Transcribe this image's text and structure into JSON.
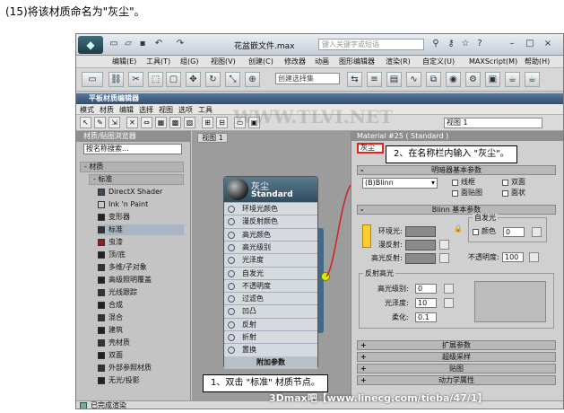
{
  "caption": "(15)将该材质命名为\"灰尘\"。",
  "app": {
    "doc_title": "花盆嵌文件.max",
    "search_placeholder": "键入关键字或短语",
    "menu": [
      "编辑(E)",
      "工具(T)",
      "组(G)",
      "视图(V)",
      "创建(C)",
      "修改器",
      "动画",
      "图形编辑器",
      "渲染(R)",
      "自定义(U)",
      "MAXScript(M)",
      "帮助(H)"
    ],
    "selection_set": "创建选择集"
  },
  "sme": {
    "title": "平板材质编辑器",
    "menu": [
      "模式",
      "材质",
      "编辑",
      "选择",
      "视图",
      "选项",
      "工具"
    ],
    "view_select": "视图 1"
  },
  "browser": {
    "header": "材质/贴图浏览器",
    "search": "按名称搜索...",
    "category": "- 材质",
    "subcategory": "- 标准",
    "items": [
      {
        "label": "DirectX Shader",
        "swatch": "#3a4a5a"
      },
      {
        "label": "Ink 'n Paint",
        "swatch": "#c8c8c8"
      },
      {
        "label": "变形器",
        "swatch": "#222222"
      },
      {
        "label": "标准",
        "swatch": "#333333"
      },
      {
        "label": "虫漆",
        "swatch": "#9a1a1a"
      },
      {
        "label": "顶/底",
        "swatch": "#222222"
      },
      {
        "label": "多维/子对象",
        "swatch": "#333333"
      },
      {
        "label": "高级照明覆盖",
        "swatch": "#222222"
      },
      {
        "label": "光线跟踪",
        "swatch": "#333333"
      },
      {
        "label": "合成",
        "swatch": "#222222"
      },
      {
        "label": "混合",
        "swatch": "#333333"
      },
      {
        "label": "建筑",
        "swatch": "#222222"
      },
      {
        "label": "壳材质",
        "swatch": "#333333"
      },
      {
        "label": "双面",
        "swatch": "#222222"
      },
      {
        "label": "外部参照材质",
        "swatch": "#333333"
      },
      {
        "label": "无光/投影",
        "swatch": "#222222"
      }
    ]
  },
  "view": {
    "tab": "视图 1"
  },
  "node": {
    "name": "灰尘",
    "type": "Standard",
    "slots": [
      "环境光颜色",
      "漫反射颜色",
      "高光颜色",
      "高光级别",
      "光泽度",
      "自发光",
      "不透明度",
      "过滤色",
      "凹凸",
      "反射",
      "折射",
      "置换"
    ],
    "more": "附加参数"
  },
  "params": {
    "header": "Material #25 ( Standard )",
    "name_value": "灰尘",
    "shader_rollout": "明暗器基本参数",
    "shader": "(B)Blinn",
    "checkboxes": [
      "线框",
      "双面",
      "面贴图",
      "面状"
    ],
    "blinn_rollout": "Blinn 基本参数",
    "self_illum": "自发光",
    "self_color": "颜色",
    "self_color_val": "0",
    "ambient": "环境光:",
    "diffuse": "漫反射:",
    "specular": "高光反射:",
    "opacity": "不透明度:",
    "opacity_val": "100",
    "spec_group": "反射高光",
    "spec_level": "高光级别:",
    "spec_level_val": "0",
    "gloss": "光泽度:",
    "gloss_val": "10",
    "soften": "柔化:",
    "soften_val": "0.1",
    "rollouts": [
      "扩展参数",
      "超级采样",
      "贴图",
      "动力学属性"
    ]
  },
  "status": "已完成渲染",
  "callouts": {
    "name_tip": "2、在名称栏内输入 \"灰尘\"。",
    "node_tip": "1、双击 \"标准\" 材质节点。"
  },
  "watermarks": {
    "mid": "WWW.TLVI.NET",
    "footer": "3Dmax吧【www.linecg.com/tieba/47/1】"
  }
}
